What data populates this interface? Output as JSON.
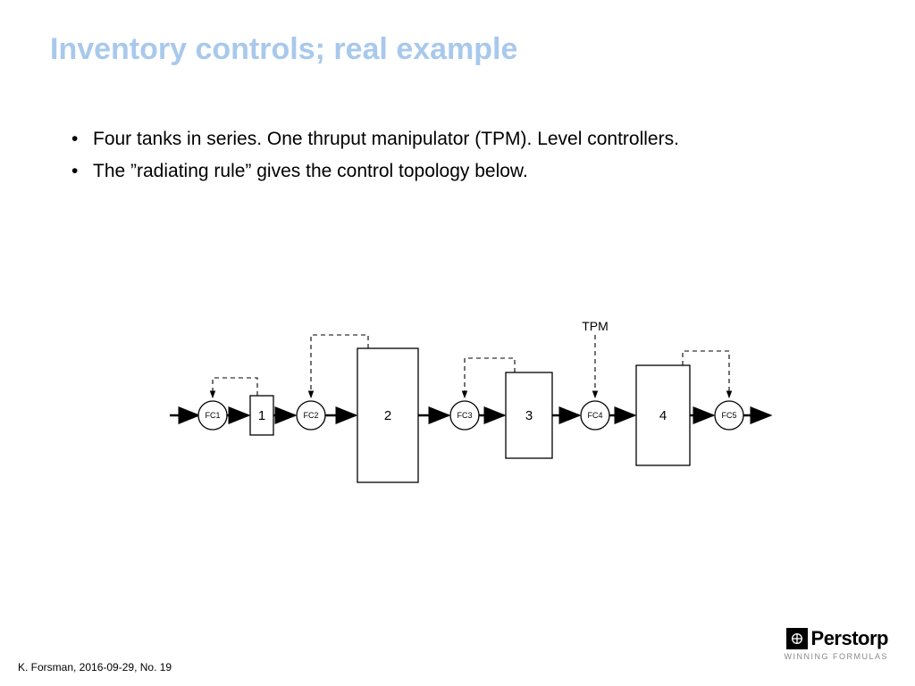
{
  "title": "Inventory controls; real example",
  "bullets": [
    "Four tanks in series. One thruput manipulator (TPM). Level controllers.",
    "The ”radiating rule” gives the control topology below."
  ],
  "diagram": {
    "tpm_label": "TPM",
    "tanks": [
      "1",
      "2",
      "3",
      "4"
    ],
    "controllers": [
      "FC1",
      "FC2",
      "FC3",
      "FC4",
      "FC5"
    ]
  },
  "footer": "K. Forsman, 2016-09-29, No. 19",
  "logo": {
    "name": "Perstorp",
    "tagline": "WINNING FORMULAS"
  }
}
